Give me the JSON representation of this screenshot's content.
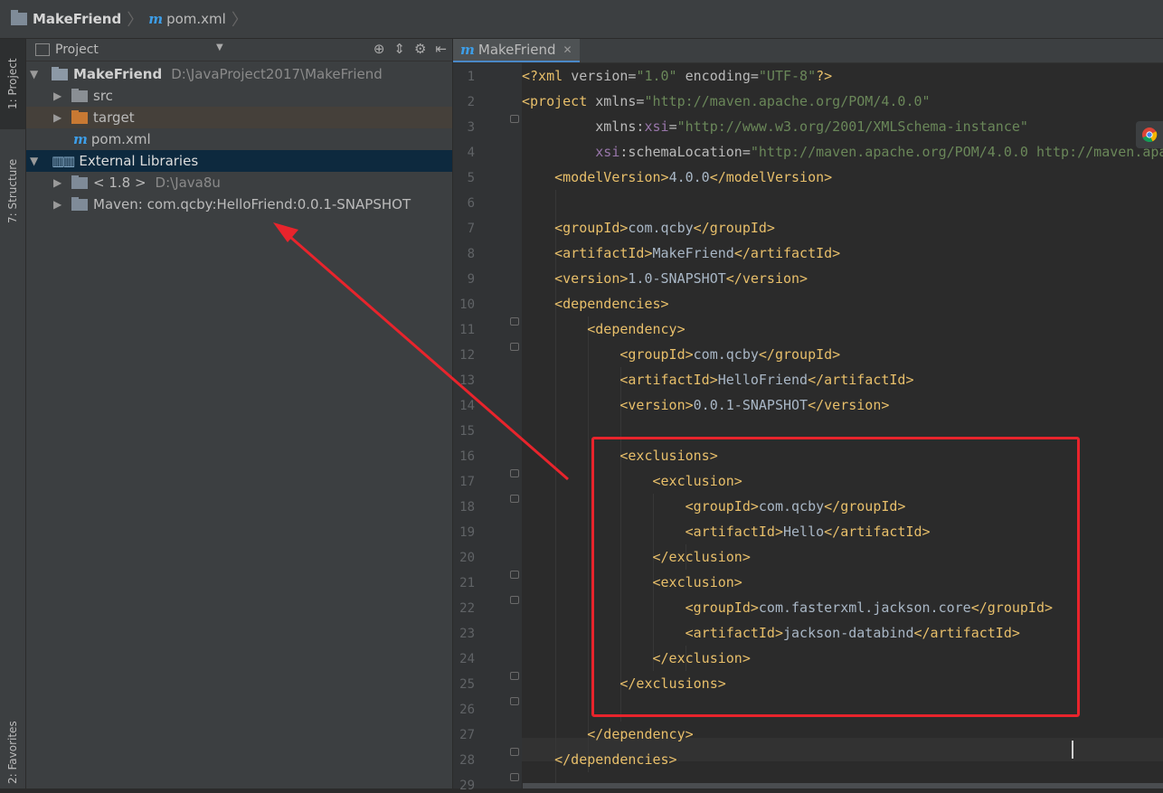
{
  "breadcrumb": {
    "project": "MakeFriend",
    "file_logo": "m",
    "file": "pom.xml"
  },
  "side_tabs": {
    "project": "1: Project",
    "structure": "7: Structure",
    "favorites": "2: Favorites"
  },
  "project_panel": {
    "title": "Project",
    "tree": {
      "root_name": "MakeFriend",
      "root_path": "D:\\JavaProject2017\\MakeFriend",
      "src": "src",
      "target": "target",
      "pom_logo": "m",
      "pom": "pom.xml",
      "ext_libs": "External Libraries",
      "jdk_name": "< 1.8 >",
      "jdk_path": "D:\\Java8u",
      "maven": "Maven: com.qcby:HelloFriend:0.0.1-SNAPSHOT"
    }
  },
  "editor": {
    "tab_logo": "m",
    "tab_label": "MakeFriend",
    "line_numbers": [
      "1",
      "2",
      "3",
      "4",
      "5",
      "6",
      "7",
      "8",
      "9",
      "10",
      "11",
      "12",
      "13",
      "14",
      "15",
      "16",
      "17",
      "18",
      "19",
      "20",
      "21",
      "22",
      "23",
      "24",
      "25",
      "26",
      "27",
      "28",
      "29"
    ],
    "code": {
      "l1_decl": "<?xml ",
      "l1_a1": "version=",
      "l1_v1": "\"1.0\"",
      "l1_a2": " encoding=",
      "l1_v2": "\"UTF-8\"",
      "l1_end": "?>",
      "l2_tag": "<project ",
      "l2_attr": "xmlns=",
      "l2_val": "\"http://maven.apache.org/POM/4.0.0\"",
      "l3_attr": "xmlns:",
      "l3_ns": "xsi",
      "l3_eq": "=",
      "l3_val": "\"http://www.w3.org/2001/XMLSchema-instance\"",
      "l4_ns": "xsi",
      "l4_attr": ":schemaLocation=",
      "l4_val": "\"http://maven.apache.org/POM/4.0.0 http://maven.apa",
      "l5_open": "<modelVersion>",
      "l5_text": "4.0.0",
      "l5_close": "</modelVersion>",
      "l7_open": "<groupId>",
      "l7_text": "com.qcby",
      "l7_close": "</groupId>",
      "l8_open": "<artifactId>",
      "l8_text": "MakeFriend",
      "l8_close": "</artifactId>",
      "l9_open": "<version>",
      "l9_text": "1.0-SNAPSHOT",
      "l9_close": "</version>",
      "l10": "<dependencies>",
      "l11": "<dependency>",
      "l12_open": "<groupId>",
      "l12_text": "com.qcby",
      "l12_close": "</groupId>",
      "l13_open": "<artifactId>",
      "l13_text": "HelloFriend",
      "l13_close": "</artifactId>",
      "l14_open": "<version>",
      "l14_text": "0.0.1-SNAPSHOT",
      "l14_close": "</version>",
      "l16": "<exclusions>",
      "l17": "<exclusion>",
      "l18_open": "<groupId>",
      "l18_text": "com.qcby",
      "l18_close": "</groupId>",
      "l19_open": "<artifactId>",
      "l19_text": "Hello",
      "l19_close": "</artifactId>",
      "l20": "</exclusion>",
      "l21": "<exclusion>",
      "l22_open": "<groupId>",
      "l22_text": "com.fasterxml.jackson.core",
      "l22_close": "</groupId>",
      "l23_open": "<artifactId>",
      "l23_text": "jackson-databind",
      "l23_close": "</artifactId>",
      "l24": "</exclusion>",
      "l25": "</exclusions>",
      "l27": "</dependency>",
      "l28": "</dependencies>"
    }
  },
  "colors": {
    "annotation_red": "#e8242c",
    "tag": "#e8bf6a",
    "value": "#6a8759",
    "namespace": "#9876aa",
    "selection": "#0d293e"
  }
}
